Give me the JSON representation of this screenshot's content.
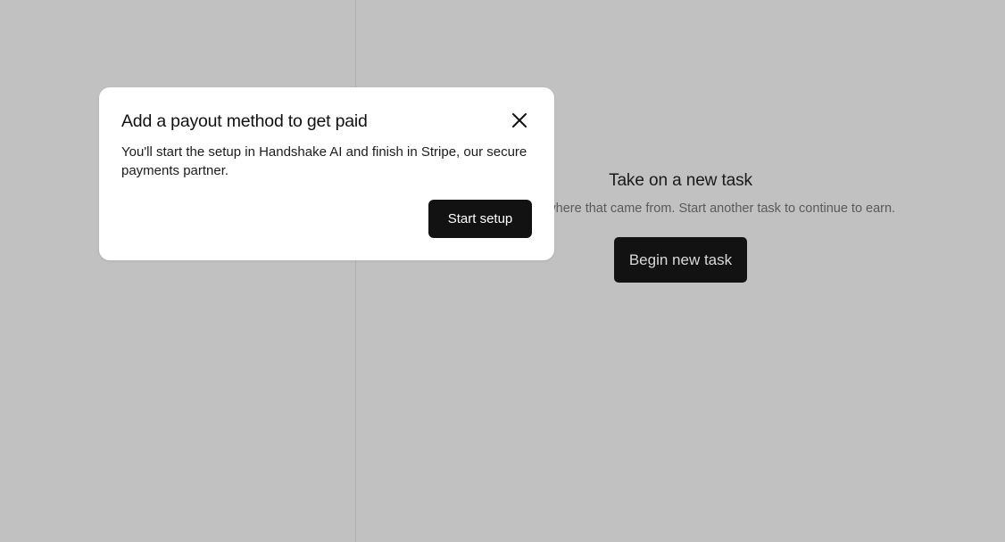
{
  "background": {
    "empty_state": {
      "title": "Take on a new task",
      "description": "Keep earning where that came from. Start another task to continue to earn.",
      "begin_button_label": "Begin new task"
    }
  },
  "modal": {
    "title": "Add a payout method to get paid",
    "body": "You'll start the setup in Handshake AI and finish in Stripe, our secure payments partner.",
    "primary_button_label": "Start setup",
    "close_icon": "close-icon"
  },
  "colors": {
    "overlay_background": "#c1c1c1",
    "primary_button": "#121212",
    "modal_background": "#ffffff"
  }
}
